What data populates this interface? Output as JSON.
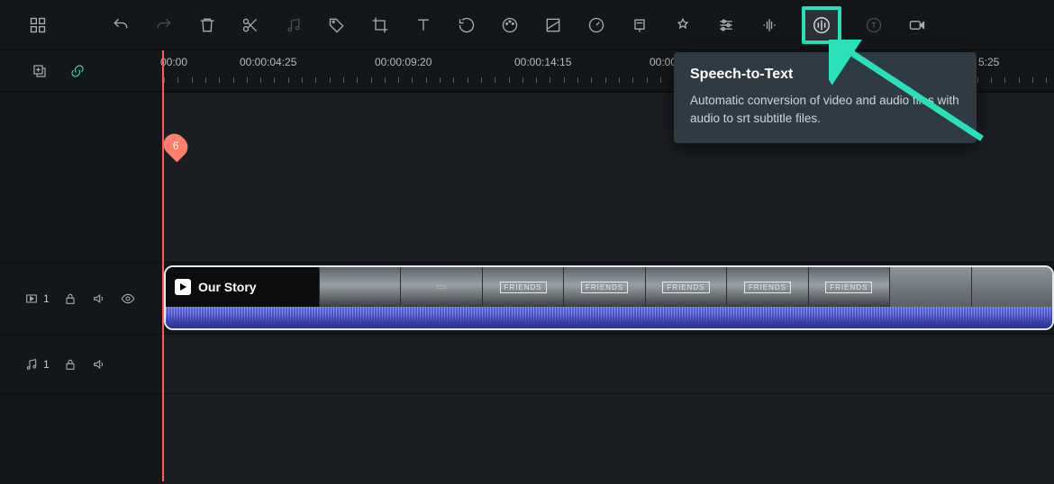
{
  "toolbar": {
    "icons": [
      "layouts",
      "undo",
      "redo",
      "delete",
      "split",
      "audio-sync",
      "tag",
      "crop",
      "text",
      "rotate",
      "color",
      "mask",
      "speed",
      "marker",
      "effects",
      "adjust",
      "voice-changer",
      "speech-to-text",
      "text-to-speech",
      "record"
    ]
  },
  "ruler": {
    "ticks": [
      "00:00",
      "00:00:04:25",
      "00:00:09:20",
      "00:00:14:15",
      "00:00:19:10",
      "5:25"
    ],
    "tick_hidden_label": "00:00:25:25"
  },
  "marker_label": "6",
  "video_track": {
    "index": "1",
    "clip_title": "Our Story",
    "friends_label": "FRIENDS"
  },
  "audio_track": {
    "index": "1"
  },
  "tooltip": {
    "title": "Speech-to-Text",
    "body": "Automatic conversion of video and audio files with audio to srt subtitle files."
  },
  "colors": {
    "accent": "#29e0b8",
    "playhead": "#ff5a5a"
  }
}
